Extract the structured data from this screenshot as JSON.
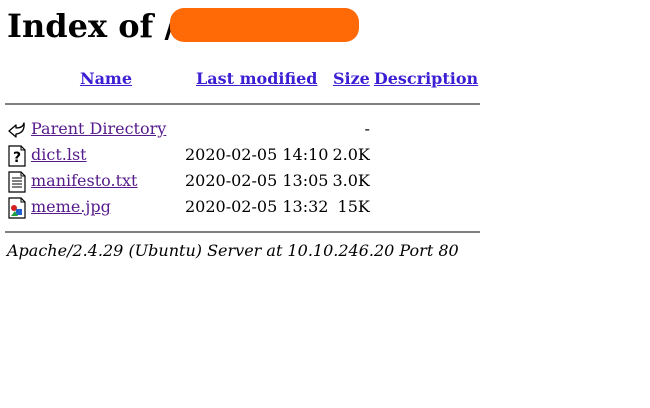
{
  "page": {
    "title": "Index of /",
    "redaction_color": "#ff6a07"
  },
  "table": {
    "headers": {
      "name": "Name",
      "last_modified": "Last modified",
      "size": "Size",
      "description": "Description"
    },
    "rows": [
      {
        "icon": "back-arrow-icon",
        "name": "Parent Directory",
        "modified": "",
        "size": "-",
        "description": ""
      },
      {
        "icon": "unknown-file-icon",
        "name": "dict.lst",
        "modified": "2020-02-05 14:10",
        "size": "2.0K",
        "description": ""
      },
      {
        "icon": "text-file-icon",
        "name": "manifesto.txt",
        "modified": "2020-02-05 13:05",
        "size": "3.0K",
        "description": ""
      },
      {
        "icon": "image-file-icon",
        "name": "meme.jpg",
        "modified": "2020-02-05 13:32",
        "size": "15K",
        "description": ""
      }
    ]
  },
  "footer": {
    "address": "Apache/2.4.29 (Ubuntu) Server at 10.10.246.20 Port 80"
  }
}
